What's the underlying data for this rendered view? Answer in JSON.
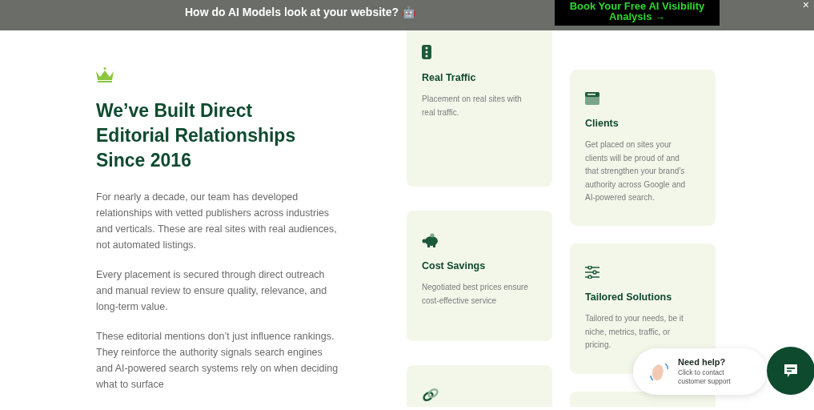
{
  "banner": {
    "text": "How do AI Models look at your website? 🤖",
    "button": "Book Your Free AI Visibility Analysis →",
    "close": "×"
  },
  "heading": "We’ve Built Direct Editorial Relationships Since 2016",
  "paragraphs": [
    "For nearly a decade, our team has developed relationships with vetted publishers across industries and verticals. These are real sites with real audiences, not automated listings.",
    "Every placement is secured through direct outreach and manual review to ensure quality, relevance, and long-term value.",
    "These editorial mentions don’t just influence rankings. They reinforce the authority signals search engines and AI-powered search systems rely on when deciding what to surface"
  ],
  "columns": [
    [
      {
        "kind": "traffic",
        "title": "Real Traffic",
        "text": "Placement on real sites with real traffic."
      },
      {
        "kind": "piggy",
        "title": "Cost Savings",
        "text": "Negotiated best prices ensure cost-effective service"
      },
      {
        "kind": "link"
      }
    ],
    [
      {
        "kind": "browser",
        "title": "Clients",
        "text": "Get placed on sites your clients will be proud of and that strengthen your brand’s authority across Google and AI-powered search."
      },
      {
        "kind": "sliders",
        "title": "Tailored Solutions",
        "text": "Tailored to your needs, be it niche, metrics, traffic, or pricing."
      },
      {
        "kind": "empty"
      }
    ]
  ],
  "help": {
    "title": "Need help?",
    "text": "Click to contact customer support"
  }
}
